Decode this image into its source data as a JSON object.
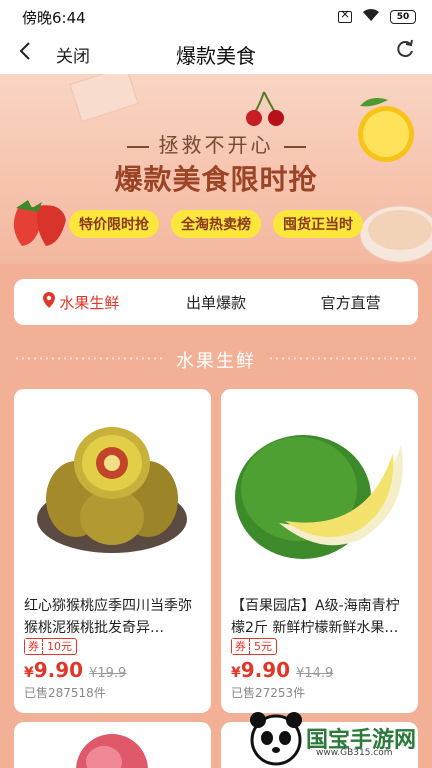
{
  "status": {
    "time": "傍晚6:44",
    "battery": "50"
  },
  "nav": {
    "close_label": "关闭",
    "title": "爆款美食"
  },
  "banner": {
    "subtitle": "拯救不开心",
    "title": "爆款美食限时抢",
    "tags": [
      "特价限时抢",
      "全淘热卖榜",
      "囤货正当时"
    ]
  },
  "tabs": [
    {
      "label": "水果生鲜",
      "active": true
    },
    {
      "label": "出单爆款",
      "active": false
    },
    {
      "label": "官方直营",
      "active": false
    }
  ],
  "section_heading": "水果生鲜",
  "products": [
    {
      "name": "红心猕猴桃应季四川当季弥猴桃泥猴桃批发奇异…",
      "coupon_label": "券",
      "coupon_value": "10元",
      "currency": "¥",
      "price": "9.90",
      "original_price": "¥19.9",
      "sold": "已售287518件"
    },
    {
      "name": "【百果园店】A级-海南青柠檬2斤 新鲜柠檬新鲜水果…",
      "coupon_label": "券",
      "coupon_value": "5元",
      "currency": "¥",
      "price": "9.90",
      "original_price": "¥14.9",
      "sold": "已售27253件"
    }
  ],
  "watermark": {
    "text": "国宝手游网",
    "url": "www.GB315.com"
  },
  "colors": {
    "accent": "#e2362a",
    "page_bg": "#f2b096",
    "tag_bg": "#fbe63c"
  }
}
